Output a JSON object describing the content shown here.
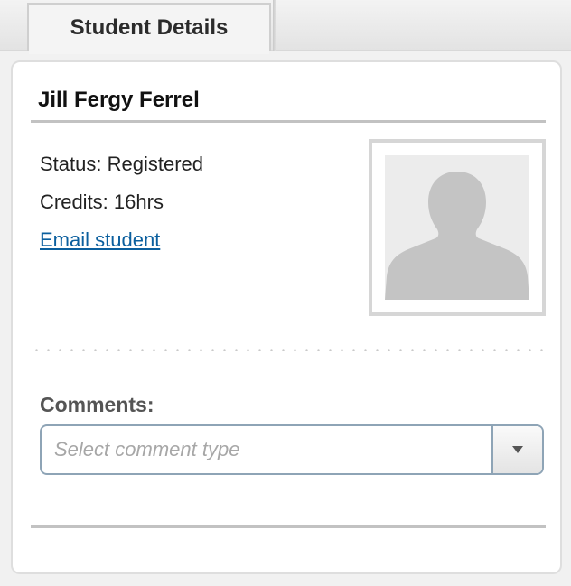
{
  "tab": {
    "label": "Student Details"
  },
  "student": {
    "name": "Jill Fergy Ferrel",
    "status": "Status: Registered",
    "credits": "Credits: 16hrs",
    "email_link": "Email student"
  },
  "comments": {
    "label": "Comments:",
    "select_placeholder": "Select comment type"
  },
  "icons": {
    "avatar": "person-silhouette-icon",
    "dropdown": "caret-down-icon"
  },
  "colors": {
    "link": "#0b5f9e",
    "select_border": "#8ea4b6",
    "rule": "#c2c2c2"
  }
}
